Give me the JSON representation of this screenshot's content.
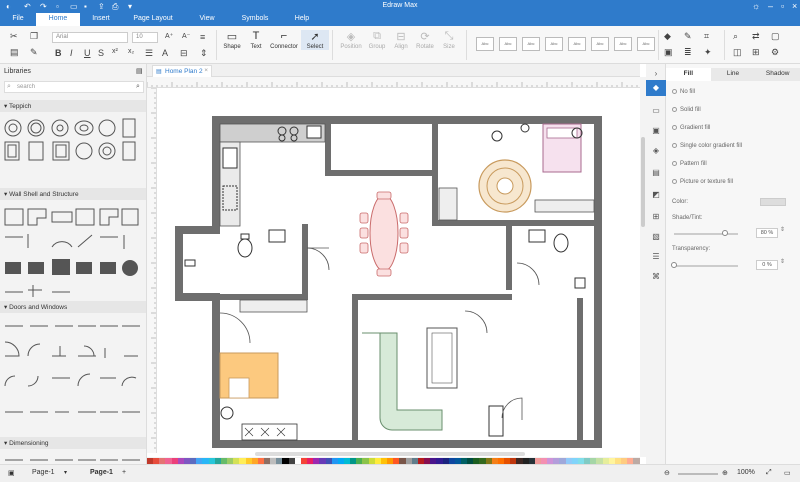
{
  "app": {
    "title": "Edraw Max"
  },
  "menu": {
    "items": [
      "File",
      "Home",
      "Insert",
      "Page Layout",
      "View",
      "Symbols",
      "Help"
    ],
    "active": "Home"
  },
  "ribbon": {
    "font_name": "Arial",
    "font_size": "10",
    "tools": [
      "Shape",
      "Text",
      "Connector",
      "Select"
    ],
    "arrange_tools": [
      "Position",
      "Group",
      "Align",
      "Rotate",
      "Size"
    ],
    "style_swatch_label": "Abc"
  },
  "library": {
    "title": "Libraries",
    "search_placeholder": "search",
    "sections": [
      "Teppich",
      "Wall Shell and Structure",
      "Doors and Windows",
      "Dimensioning"
    ]
  },
  "document": {
    "tab_label": "Home Plan 2"
  },
  "properties": {
    "tabs": [
      "Fill",
      "Line",
      "Shadow"
    ],
    "fill_options": [
      "No fill",
      "Solid fill",
      "Gradient fill",
      "Single color gradient fill",
      "Pattern fill",
      "Picture or texture fill"
    ],
    "color_label": "Color:",
    "shade_label": "Shade/Tint:",
    "shade_value": "80 %",
    "shade_fraction": 0.8,
    "transparency_label": "Transparency:",
    "transparency_value": "0 %",
    "transparency_fraction": 0
  },
  "status": {
    "page_selector": "Page-1",
    "page_tab": "Page-1",
    "zoom": "100%"
  },
  "palette": [
    "#c0392b",
    "#e74c3c",
    "#e57373",
    "#f06292",
    "#ec407a",
    "#ab47bc",
    "#7e57c2",
    "#5c6bc0",
    "#42a5f5",
    "#29b6f6",
    "#26c6da",
    "#26a69a",
    "#66bb6a",
    "#9ccc65",
    "#d4e157",
    "#ffee58",
    "#ffca28",
    "#ffa726",
    "#ff7043",
    "#8d6e63",
    "#bdbdbd",
    "#78909c",
    "#000000",
    "#424242",
    "#ffffff",
    "#f44336",
    "#e91e63",
    "#9c27b0",
    "#673ab7",
    "#3f51b5",
    "#2196f3",
    "#03a9f4",
    "#00bcd4",
    "#009688",
    "#4caf50",
    "#8bc34a",
    "#cddc39",
    "#ffeb3b",
    "#ffc107",
    "#ff9800",
    "#ff5722",
    "#795548",
    "#9e9e9e",
    "#607d8b",
    "#b71c1c",
    "#880e4f",
    "#4a148c",
    "#311b92",
    "#1a237e",
    "#0d47a1",
    "#01579b",
    "#006064",
    "#004d40",
    "#1b5e20",
    "#33691e",
    "#827717",
    "#f57f17",
    "#ff6f00",
    "#e65100",
    "#bf360c",
    "#3e2723",
    "#212121",
    "#263238",
    "#ef9a9a",
    "#f48fb1",
    "#ce93d8",
    "#b39ddb",
    "#9fa8da",
    "#90caf9",
    "#81d4fa",
    "#80deea",
    "#80cbc4",
    "#a5d6a7",
    "#c5e1a5",
    "#e6ee9c",
    "#fff59d",
    "#ffe082",
    "#ffcc80",
    "#ffab91",
    "#bcaaa4"
  ]
}
